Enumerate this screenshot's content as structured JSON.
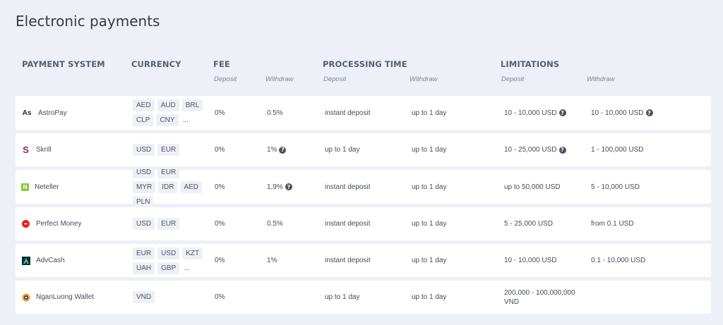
{
  "page": {
    "title": "Electronic payments"
  },
  "headers": {
    "payment_system": "PAYMENT SYSTEM",
    "currency": "CURRENCY",
    "fee": "FEE",
    "processing_time": "PROCESSING TIME",
    "limitations": "LIMITATIONS",
    "fee_deposit": "Deposit",
    "fee_withdraw": "Withdraw",
    "proc_deposit": "Deposit",
    "proc_withdraw": "Withdraw",
    "lim_deposit": "Deposit",
    "lim_withdraw": "Withdraw"
  },
  "rows": [
    {
      "name": "AstroPay",
      "logo": "astropay-logo-icon",
      "logo_text": "As",
      "currencies": [
        "AED",
        "AUD",
        "BRL",
        "CLP",
        "CNY"
      ],
      "more": "...",
      "fee_deposit": "0%",
      "fee_withdraw": "0.5%",
      "proc_deposit": "instant deposit",
      "proc_withdraw": "up to 1 day",
      "lim_deposit": "10 - 10,000 USD",
      "lim_withdraw": "10 - 10,000 USD"
    },
    {
      "name": "Skrill",
      "logo": "skrill-logo-icon",
      "logo_text": "S",
      "currencies": [
        "USD",
        "EUR"
      ],
      "more": "",
      "fee_deposit": "0%",
      "fee_withdraw": "1%",
      "proc_deposit": "up to 1 day",
      "proc_withdraw": "up to 1 day",
      "lim_deposit": "10 - 25,000 USD",
      "lim_withdraw": "1 - 100,000 USD"
    },
    {
      "name": "Neteller",
      "logo": "neteller-logo-icon",
      "logo_text": "N",
      "currencies": [
        "USD",
        "EUR",
        "MYR",
        "IDR",
        "AED",
        "PLN"
      ],
      "more": "",
      "fee_deposit": "0%",
      "fee_withdraw": "1,9%",
      "proc_deposit": "instant deposit",
      "proc_withdraw": "up to 1 day",
      "lim_deposit": "up to 50,000 USD",
      "lim_withdraw": "5 - 10,000 USD"
    },
    {
      "name": "Perfect Money",
      "logo": "perfect-money-logo-icon",
      "logo_text": "",
      "currencies": [
        "USD",
        "EUR"
      ],
      "more": "",
      "fee_deposit": "0%",
      "fee_withdraw": "0.5%",
      "proc_deposit": "instant deposit",
      "proc_withdraw": "up to 1 day",
      "lim_deposit": "5 - 25,000 USD",
      "lim_withdraw": "from 0.1 USD"
    },
    {
      "name": "AdvCash",
      "logo": "advcash-logo-icon",
      "logo_text": "",
      "currencies": [
        "EUR",
        "USD",
        "KZT",
        "UAH",
        "GBP"
      ],
      "more": "...",
      "fee_deposit": "0%",
      "fee_withdraw": "1%",
      "proc_deposit": "instant deposit",
      "proc_withdraw": "up to 1 day",
      "lim_deposit": "10 - 10,000 USD",
      "lim_withdraw": "0.1 - 10,000 USD"
    },
    {
      "name": "NganLuong Wallet",
      "logo": "nganluong-logo-icon",
      "logo_text": "",
      "currencies": [
        "VND"
      ],
      "more": "",
      "fee_deposit": "0%",
      "fee_withdraw": "",
      "proc_deposit": "up to 1 day",
      "proc_withdraw": "up to 1 day",
      "lim_deposit": "200,000 - 100,000,000 VND",
      "lim_withdraw": ""
    }
  ],
  "colors": {
    "background": "#eef0f7",
    "row_background": "#ffffff",
    "chip_background": "#eef0f5",
    "skrill": "#862165",
    "neteller": "#8dc63f",
    "perfect_money": "#e2231a",
    "advcash": "#0f2b34",
    "nganluong": "#f4a21d"
  }
}
